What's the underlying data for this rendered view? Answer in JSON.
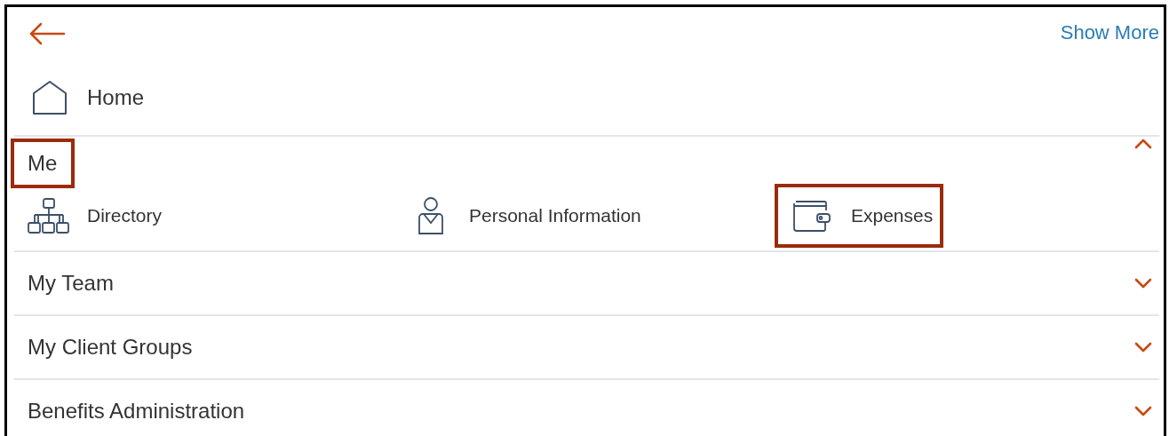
{
  "header": {
    "show_more": "Show More"
  },
  "home": {
    "label": "Home"
  },
  "sections": [
    {
      "title": "Me",
      "expanded": true,
      "highlighted": true,
      "items": [
        {
          "kind": "directory",
          "label": "Directory",
          "highlighted": false
        },
        {
          "kind": "person",
          "label": "Personal Information",
          "highlighted": false
        },
        {
          "kind": "wallet",
          "label": "Expenses",
          "highlighted": true
        }
      ]
    },
    {
      "title": "My Team",
      "expanded": false,
      "highlighted": false
    },
    {
      "title": "My Client Groups",
      "expanded": false,
      "highlighted": false
    },
    {
      "title": "Benefits Administration",
      "expanded": false,
      "highlighted": false
    }
  ]
}
